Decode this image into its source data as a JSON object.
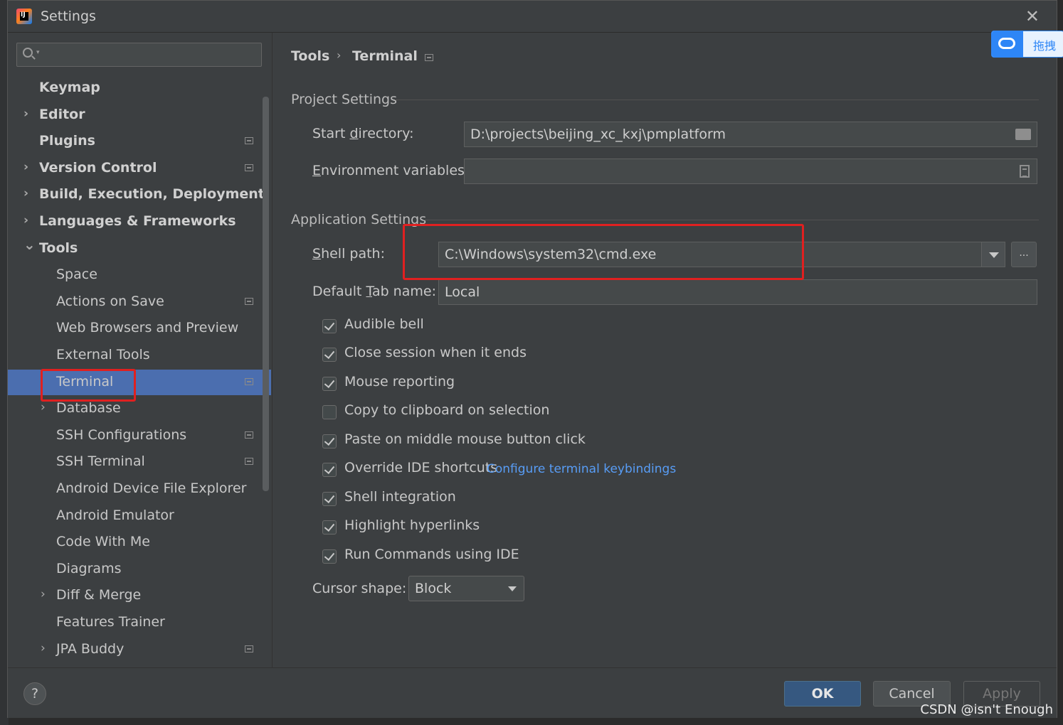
{
  "window": {
    "title": "Settings"
  },
  "sidebar": {
    "search_placeholder": "",
    "items": [
      {
        "label": "Keymap",
        "bold": true,
        "expandable": false,
        "expanded": false,
        "level": 0,
        "project_icon": false,
        "selected": false
      },
      {
        "label": "Editor",
        "bold": true,
        "expandable": true,
        "expanded": false,
        "level": 0,
        "project_icon": false,
        "selected": false
      },
      {
        "label": "Plugins",
        "bold": true,
        "expandable": false,
        "expanded": false,
        "level": 0,
        "project_icon": true,
        "selected": false
      },
      {
        "label": "Version Control",
        "bold": true,
        "expandable": true,
        "expanded": false,
        "level": 0,
        "project_icon": true,
        "selected": false
      },
      {
        "label": "Build, Execution, Deployment",
        "bold": true,
        "expandable": true,
        "expanded": false,
        "level": 0,
        "project_icon": false,
        "selected": false
      },
      {
        "label": "Languages & Frameworks",
        "bold": true,
        "expandable": true,
        "expanded": false,
        "level": 0,
        "project_icon": false,
        "selected": false
      },
      {
        "label": "Tools",
        "bold": true,
        "expandable": true,
        "expanded": true,
        "level": 0,
        "project_icon": false,
        "selected": false
      },
      {
        "label": "Space",
        "bold": false,
        "expandable": false,
        "expanded": false,
        "level": 1,
        "project_icon": false,
        "selected": false
      },
      {
        "label": "Actions on Save",
        "bold": false,
        "expandable": false,
        "expanded": false,
        "level": 1,
        "project_icon": true,
        "selected": false
      },
      {
        "label": "Web Browsers and Preview",
        "bold": false,
        "expandable": false,
        "expanded": false,
        "level": 1,
        "project_icon": false,
        "selected": false
      },
      {
        "label": "External Tools",
        "bold": false,
        "expandable": false,
        "expanded": false,
        "level": 1,
        "project_icon": false,
        "selected": false
      },
      {
        "label": "Terminal",
        "bold": false,
        "expandable": false,
        "expanded": false,
        "level": 1,
        "project_icon": true,
        "selected": true
      },
      {
        "label": "Database",
        "bold": false,
        "expandable": true,
        "expanded": false,
        "level": 1,
        "project_icon": false,
        "selected": false
      },
      {
        "label": "SSH Configurations",
        "bold": false,
        "expandable": false,
        "expanded": false,
        "level": 1,
        "project_icon": true,
        "selected": false
      },
      {
        "label": "SSH Terminal",
        "bold": false,
        "expandable": false,
        "expanded": false,
        "level": 1,
        "project_icon": true,
        "selected": false
      },
      {
        "label": "Android Device File Explorer",
        "bold": false,
        "expandable": false,
        "expanded": false,
        "level": 1,
        "project_icon": false,
        "selected": false
      },
      {
        "label": "Android Emulator",
        "bold": false,
        "expandable": false,
        "expanded": false,
        "level": 1,
        "project_icon": false,
        "selected": false
      },
      {
        "label": "Code With Me",
        "bold": false,
        "expandable": false,
        "expanded": false,
        "level": 1,
        "project_icon": false,
        "selected": false
      },
      {
        "label": "Diagrams",
        "bold": false,
        "expandable": false,
        "expanded": false,
        "level": 1,
        "project_icon": false,
        "selected": false
      },
      {
        "label": "Diff & Merge",
        "bold": false,
        "expandable": true,
        "expanded": false,
        "level": 1,
        "project_icon": false,
        "selected": false
      },
      {
        "label": "Features Trainer",
        "bold": false,
        "expandable": false,
        "expanded": false,
        "level": 1,
        "project_icon": false,
        "selected": false
      },
      {
        "label": "JPA Buddy",
        "bold": false,
        "expandable": true,
        "expanded": false,
        "level": 1,
        "project_icon": true,
        "selected": false
      }
    ]
  },
  "breadcrumb": {
    "parent": "Tools",
    "current": "Terminal"
  },
  "project_settings": {
    "heading": "Project Settings",
    "start_directory": {
      "label_pre": "Start ",
      "label_key": "d",
      "label_post": "irectory:",
      "value": "D:\\projects\\beijing_xc_kxj\\pmplatform"
    },
    "env_vars": {
      "label_pre": "",
      "label_key": "E",
      "label_post": "nvironment variables:",
      "value": ""
    }
  },
  "app_settings": {
    "heading": "Application Settings",
    "shell_path": {
      "label_pre": "",
      "label_key": "S",
      "label_post": "hell path:",
      "value": "C:\\Windows\\system32\\cmd.exe",
      "browse_label": "..."
    },
    "default_tab": {
      "label_pre": "Default ",
      "label_key": "T",
      "label_post": "ab name:",
      "value": "Local"
    },
    "checkboxes": [
      {
        "label": "Audible bell",
        "checked": true
      },
      {
        "label": "Close session when it ends",
        "checked": true
      },
      {
        "label": "Mouse reporting",
        "checked": true
      },
      {
        "label": "Copy to clipboard on selection",
        "checked": false
      },
      {
        "label": "Paste on middle mouse button click",
        "checked": true
      },
      {
        "label": "Override IDE shortcuts",
        "checked": true
      },
      {
        "label": "Shell integration",
        "checked": true
      },
      {
        "label": "Highlight hyperlinks",
        "checked": true
      },
      {
        "label": "Run Commands using IDE",
        "checked": true
      }
    ],
    "keybindings_link": "Configure terminal keybindings",
    "cursor_shape": {
      "label": "Cursor shape:",
      "value": "Block"
    }
  },
  "footer": {
    "help": "?",
    "ok": "OK",
    "cancel": "Cancel",
    "apply": "Apply"
  },
  "overlay": {
    "baidu_text": "拖拽",
    "watermark": "CSDN @isn't  Enough"
  },
  "colors": {
    "selection": "#4b6eaf",
    "highlight_box": "#e02020",
    "link": "#589df6",
    "ok_button": "#365880"
  }
}
